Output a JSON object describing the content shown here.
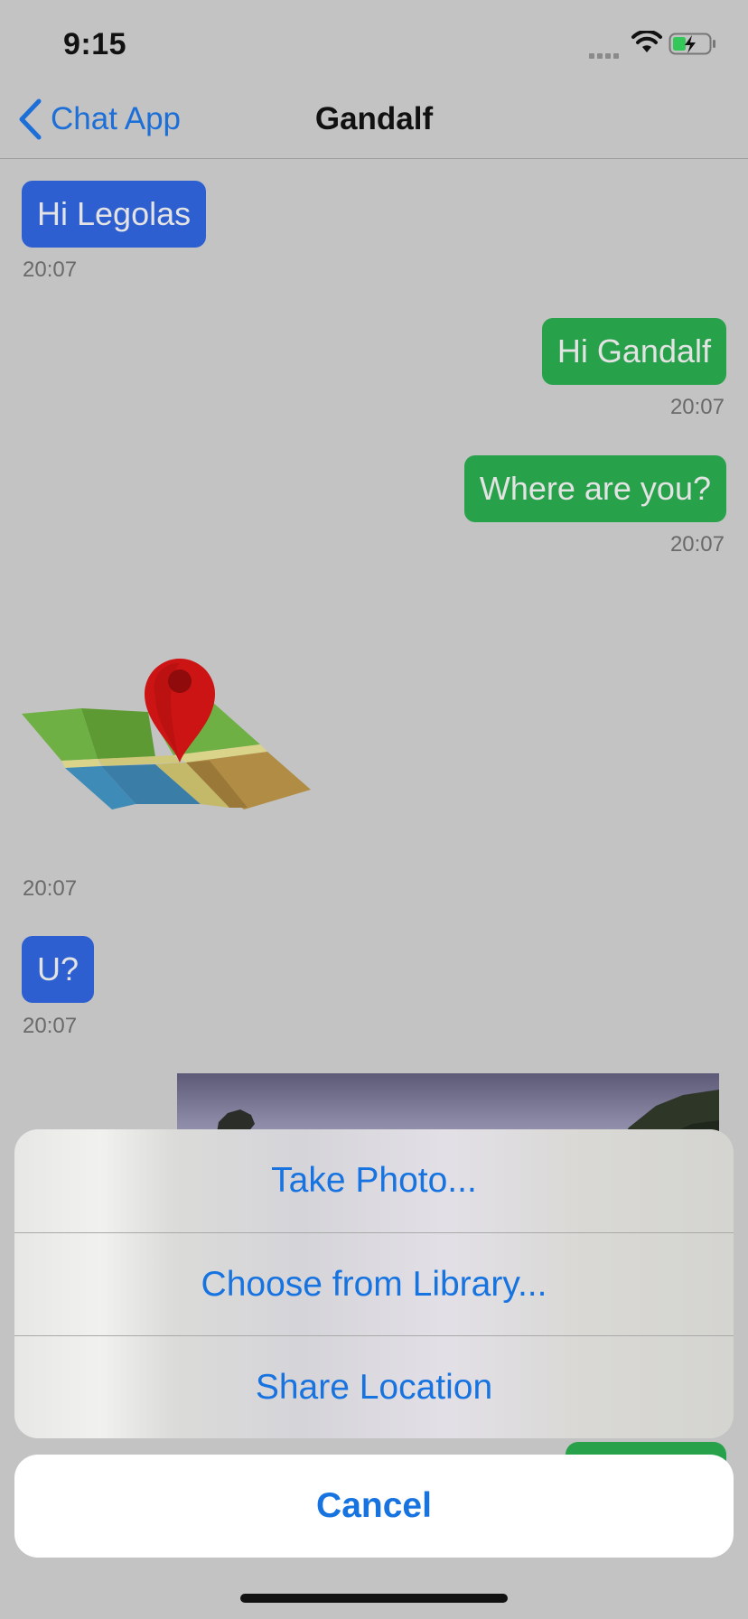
{
  "status_bar": {
    "time": "9:15"
  },
  "nav": {
    "back_label": "Chat App",
    "title": "Gandalf"
  },
  "messages": [
    {
      "kind": "text",
      "side": "received",
      "text": "Hi Legolas",
      "time": "20:07"
    },
    {
      "kind": "text",
      "side": "sent",
      "text": "Hi Gandalf",
      "time": "20:07"
    },
    {
      "kind": "text",
      "side": "sent",
      "text": "Where are you?",
      "time": "20:07"
    },
    {
      "kind": "location",
      "side": "received",
      "icon": "map-location-icon",
      "time": "20:07"
    },
    {
      "kind": "text",
      "side": "received",
      "text": "U?",
      "time": "20:07"
    },
    {
      "kind": "photo",
      "side": "sent"
    }
  ],
  "action_sheet": {
    "options": [
      "Take Photo...",
      "Choose from Library...",
      "Share Location"
    ],
    "cancel": "Cancel"
  },
  "colors": {
    "received_bubble": "#2d5fd1",
    "sent_bubble": "#27a14a",
    "accent": "#1673e0"
  }
}
